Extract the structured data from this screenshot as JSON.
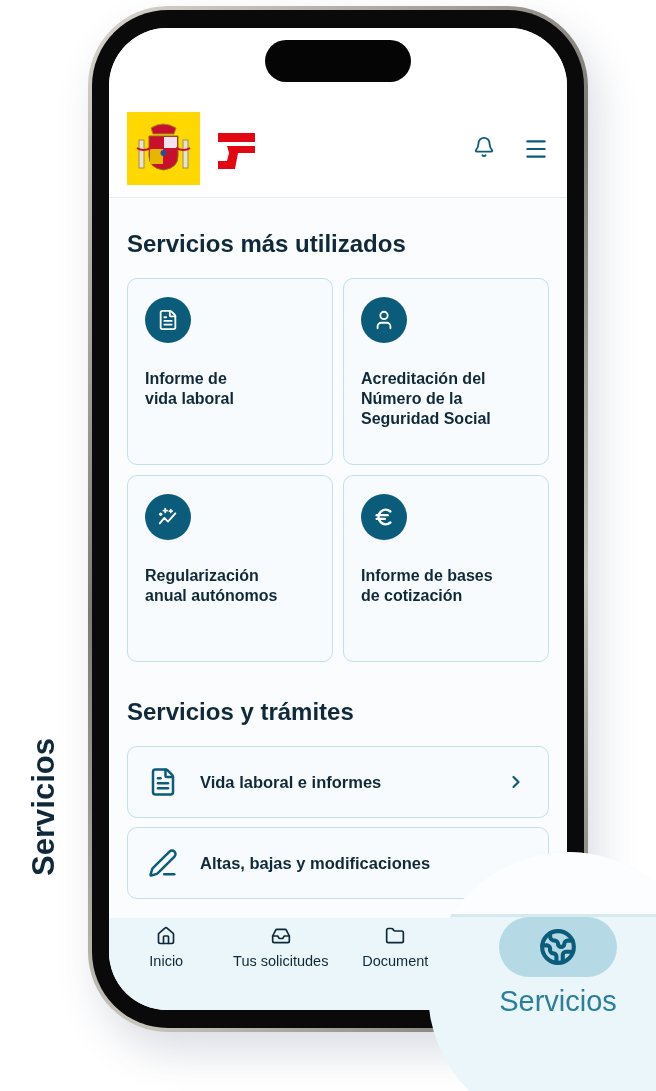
{
  "side_label": "Servicios",
  "most_used": {
    "title": "Servicios más utilizados",
    "cards": [
      {
        "kind": "document",
        "label": "Informe de\nvida laboral"
      },
      {
        "kind": "person",
        "label": "Acreditación del\nNúmero de la\nSeguridad Social"
      },
      {
        "kind": "trend",
        "label": "Regularización\nanual autónomos"
      },
      {
        "kind": "euro",
        "label": "Informe de bases\nde cotización"
      }
    ]
  },
  "procedures": {
    "title": "Servicios y trámites",
    "items": [
      {
        "kind": "document",
        "label": "Vida laboral e informes",
        "chevron": true
      },
      {
        "kind": "edit",
        "label": "Altas, bajas y modificaciones",
        "chevron": false
      }
    ]
  },
  "nav": [
    {
      "kind": "home",
      "label": "Inicio",
      "selected": false
    },
    {
      "kind": "inbox",
      "label": "Tus solicitudes",
      "selected": false
    },
    {
      "kind": "folder",
      "label": "Document",
      "selected": false
    }
  ],
  "magnifier": {
    "kind": "globe",
    "label": "Servicios",
    "selected": true
  }
}
